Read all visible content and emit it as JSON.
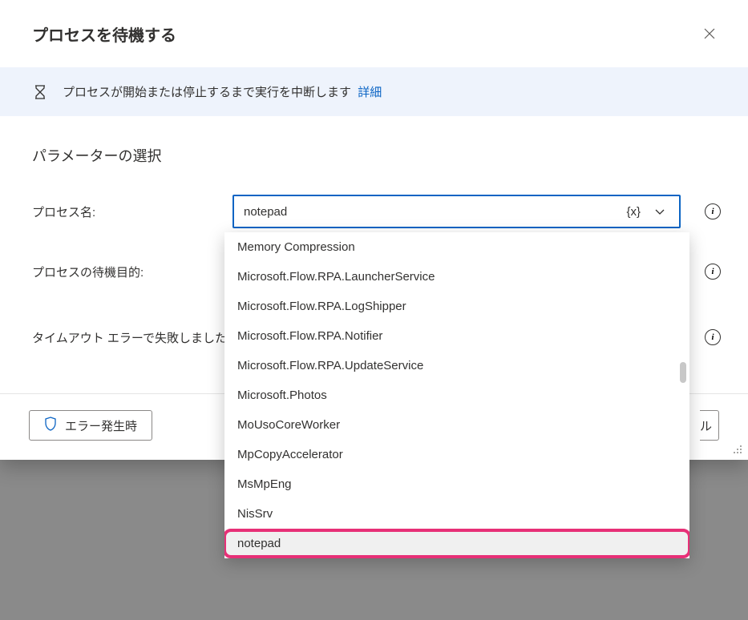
{
  "dialog": {
    "title": "プロセスを待機する",
    "info_text": "プロセスが開始または停止するまで実行を中断します",
    "info_link": "詳細",
    "section_title": "パラメーターの選択"
  },
  "params": {
    "process_name_label": "プロセス名:",
    "process_name_value": "notepad",
    "wait_purpose_label": "プロセスの待機目的:",
    "timeout_label": "タイムアウト エラーで失敗しました:"
  },
  "footer": {
    "on_error": "エラー発生時",
    "cancel_partial": "ル"
  },
  "var_token": "{x}",
  "dropdown": {
    "items": [
      "Memory Compression",
      "Microsoft.Flow.RPA.LauncherService",
      "Microsoft.Flow.RPA.LogShipper",
      "Microsoft.Flow.RPA.Notifier",
      "Microsoft.Flow.RPA.UpdateService",
      "Microsoft.Photos",
      "MoUsoCoreWorker",
      "MpCopyAccelerator",
      "MsMpEng",
      "NisSrv",
      "notepad"
    ],
    "highlighted_index": 10
  }
}
